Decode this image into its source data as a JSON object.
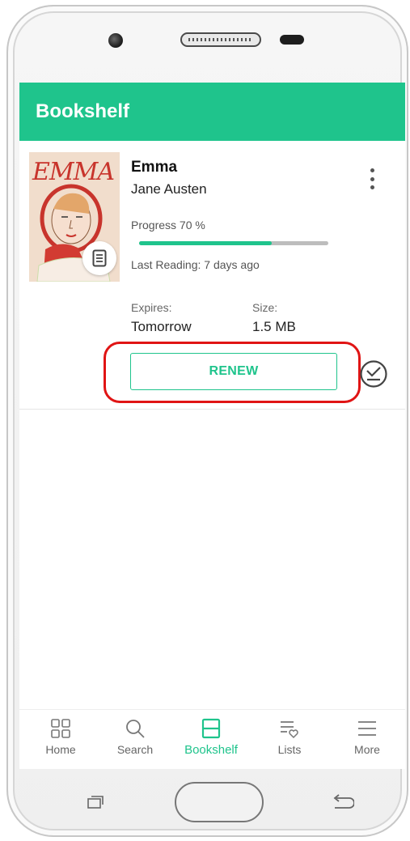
{
  "app_bar": {
    "title": "Bookshelf"
  },
  "book": {
    "cover_title": "EMMA",
    "title": "Emma",
    "author": "Jane Austen",
    "progress_label": "Progress 70 %",
    "progress_value": 0.7,
    "last_reading": "Last Reading: 7 days ago",
    "expires_label": "Expires:",
    "expires_value": "Tomorrow",
    "size_label": "Size:",
    "size_value": "1.5 MB",
    "renew_label": "RENEW",
    "cover_badge_icon": "document-icon",
    "return_icon": "return-check-icon"
  },
  "bottom_nav": {
    "items": [
      {
        "label": "Home",
        "icon": "grid-icon",
        "active": false
      },
      {
        "label": "Search",
        "icon": "search-icon",
        "active": false
      },
      {
        "label": "Bookshelf",
        "icon": "bookshelf-icon",
        "active": true
      },
      {
        "label": "Lists",
        "icon": "list-heart-icon",
        "active": false
      },
      {
        "label": "More",
        "icon": "menu-icon",
        "active": false
      }
    ]
  },
  "colors": {
    "accent": "#1fc48c",
    "highlight": "#e01414"
  }
}
